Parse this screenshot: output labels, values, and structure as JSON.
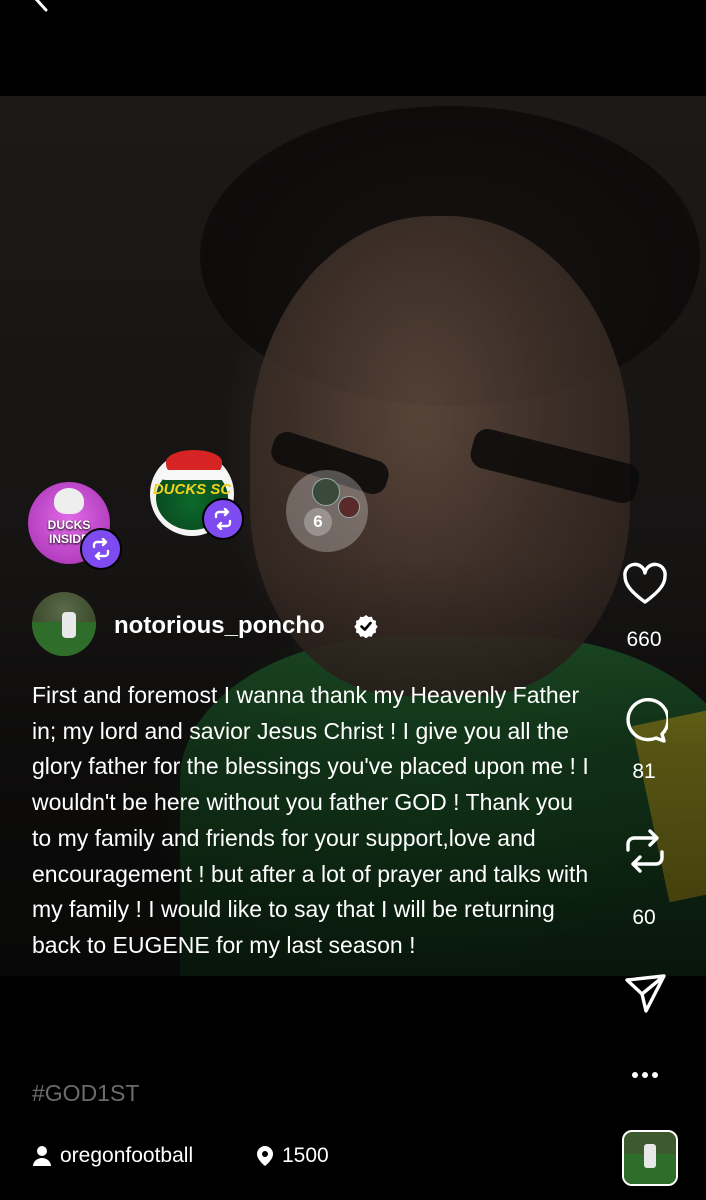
{
  "post": {
    "author": "notorious_poncho",
    "caption": "First and foremost I wanna thank my Heavenly Father in; my lord and savior Jesus Christ !  I give you all the glory father for the blessings you've placed upon me ! I wouldn't be here without you father GOD ! Thank you to my family and friends for your support,love and encouragement ! but after a lot of prayer and talks with my family ! I would like to say that I will be returning back to EUGENE for my last season !",
    "hashtag": "#GOD1ST"
  },
  "reposters": {
    "bubble1_text": "DUCKS INSIDE",
    "bubble2_text": "DUCKS SC",
    "more_count": "6"
  },
  "actions": {
    "likes": "660",
    "comments": "81",
    "reposts": "60"
  },
  "footer": {
    "tagged_user": "oregonfootball",
    "location_count": "1500"
  },
  "colors": {
    "repost_badge": "#7d4bf0",
    "background": "#000000",
    "hashtag": "#6b6b6b"
  },
  "icons": [
    "back-icon",
    "repost-icon",
    "verified-icon",
    "heart-icon",
    "comment-icon",
    "share-icon",
    "send-icon",
    "more-icon",
    "person-icon",
    "location-pin-icon"
  ]
}
